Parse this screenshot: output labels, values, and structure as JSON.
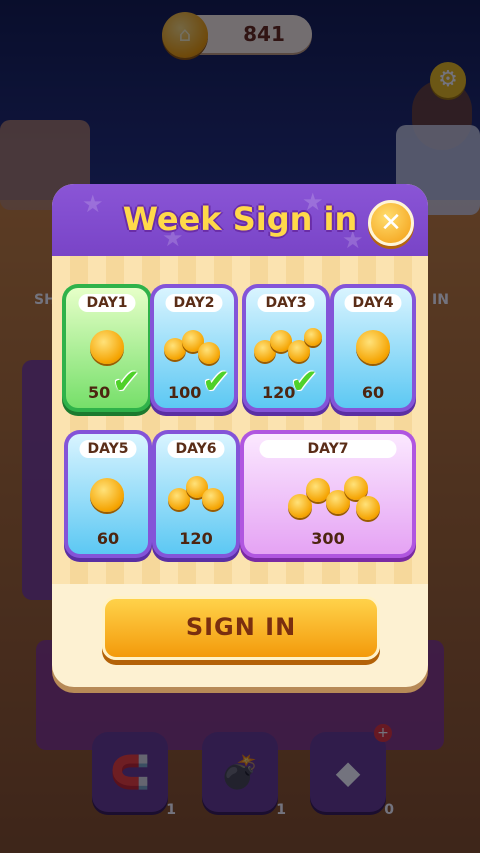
{
  "hud": {
    "coins": "841",
    "coin_icon": "home-coin-icon",
    "settings_icon": "gear-icon"
  },
  "background": {
    "left_label": "SH",
    "right_label": "IN",
    "tools": [
      {
        "count": "1"
      },
      {
        "count": "1"
      },
      {
        "count": "0"
      }
    ]
  },
  "dialog": {
    "title": "Week Sign in",
    "close_icon": "close-icon",
    "days": [
      {
        "label": "DAY1",
        "reward": "50",
        "claimed": true
      },
      {
        "label": "DAY2",
        "reward": "100",
        "claimed": true
      },
      {
        "label": "DAY3",
        "reward": "120",
        "claimed": true
      },
      {
        "label": "DAY4",
        "reward": "60",
        "claimed": false
      },
      {
        "label": "DAY5",
        "reward": "60",
        "claimed": false
      },
      {
        "label": "DAY6",
        "reward": "120",
        "claimed": false
      },
      {
        "label": "DAY7",
        "reward": "300",
        "claimed": false
      }
    ],
    "sign_in_label": "SIGN IN"
  },
  "colors": {
    "accent_purple": "#8454d8",
    "claimed_green": "#2fb24a",
    "button_orange": "#f39a0b"
  }
}
